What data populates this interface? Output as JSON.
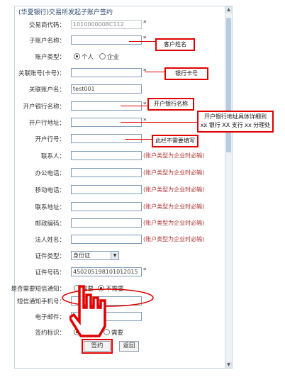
{
  "title": "(华夏银行)交易所发起子账户签约",
  "form": {
    "trade_code_label": "交易商代码：",
    "trade_code_value": "1010000008C112",
    "sub_account_name_label": "子账户名称：",
    "account_type_label": "账户类型：",
    "account_type_personal": "个人",
    "account_type_enterprise": "企业",
    "linked_account_label": "关联账号(卡号)：",
    "linked_account_name_label": "关联账户名：",
    "linked_account_name_value": "test001",
    "bank_name_label": "开户银行名称：",
    "bank_address_label": "开户行地址：",
    "bank_number_label": "开户行号：",
    "contact_label": "联系人：",
    "office_phone_label": "办公电话：",
    "mobile_label": "移动电话：",
    "contact_address_label": "联系地址：",
    "postcode_label": "邮政编码：",
    "legal_person_label": "法人姓名：",
    "id_type_label": "证件类型：",
    "id_type_value": "身份证",
    "id_number_label": "证件号码：",
    "id_number_value": "450205198101012015",
    "sms_label": "是否需要短信通知：",
    "sms_yes": "需要",
    "sms_no": "不需要",
    "sms_phone_label": "短信通知手机号：",
    "email_label": "电子邮件：",
    "sign_flag_label": "签约标识：",
    "sign_flag_yes": "需要",
    "sign_flag_no": "需要",
    "required_mark": "*",
    "enterprise_required_hint": "(账户类型为企业时必输)",
    "sign_button": "签约",
    "back_button": "返回"
  },
  "annotations": {
    "customer_name": "客户姓名",
    "bank_card_number": "银行卡号",
    "bank_name": "开户银行名称",
    "branch_address_line1": "开户银行地址具体详细到",
    "branch_address_line2": "xx 银行 XX 支行 xx 分理处",
    "no_need": "此栏不需要填写"
  },
  "colors": {
    "annotation_red": "#e00000",
    "hint_red": "#b03030",
    "frame_border": "#c7d3df"
  }
}
